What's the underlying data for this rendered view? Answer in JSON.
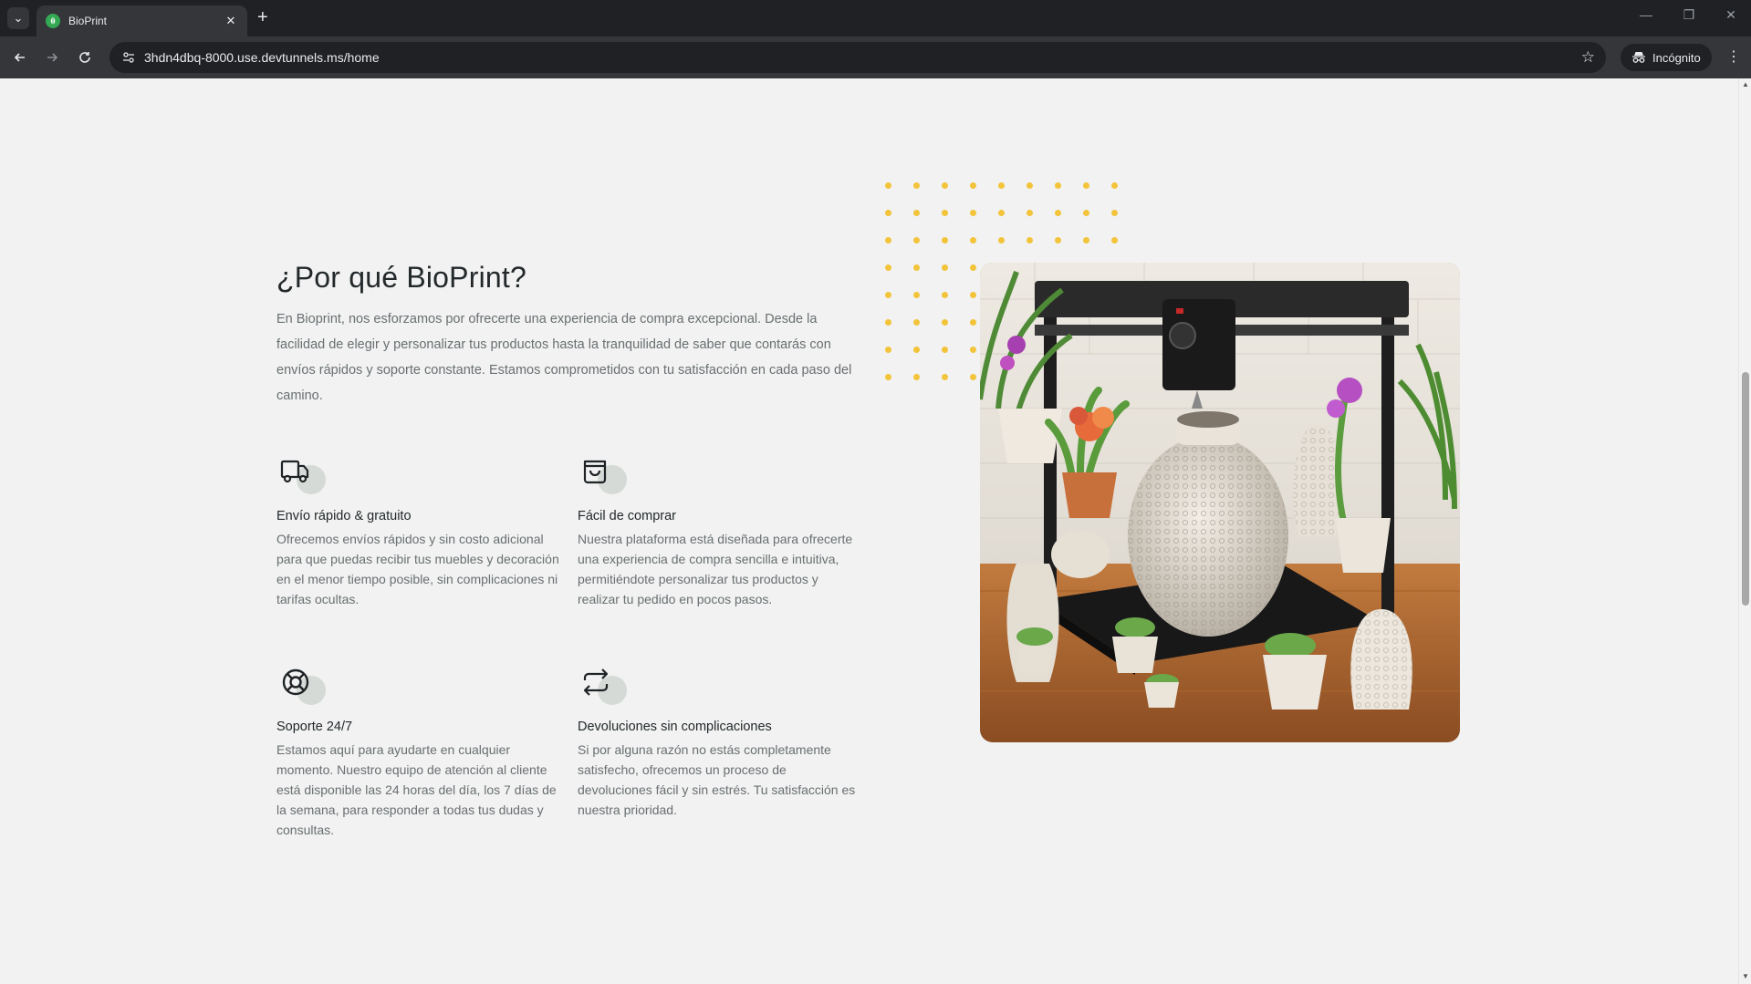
{
  "browser": {
    "tab_title": "BioPrint",
    "url_host": "3hdn4dbq-8000.use.devtunnels.ms",
    "url_path": "/home",
    "incognito_label": "Incógnito"
  },
  "section": {
    "title": "¿Por qué BioPrint?",
    "intro": "En Bioprint, nos esforzamos por ofrecerte una experiencia de compra excepcional. Desde la facilidad de elegir y personalizar tus productos hasta la tranquilidad de saber que contarás con envíos rápidos y soporte constante. Estamos comprometidos con tu satisfacción en cada paso del camino."
  },
  "features": [
    {
      "icon": "truck-icon",
      "title": "Envío rápido & gratuito",
      "text": "Ofrecemos envíos rápidos y sin costo adicional para que puedas recibir tus muebles y decoración en el menor tiempo posible, sin complicaciones ni tarifas ocultas."
    },
    {
      "icon": "shopping-bag-icon",
      "title": "Fácil de comprar",
      "text": "Nuestra plataforma está diseñada para ofrecerte una experiencia de compra sencilla e intuitiva, permitiéndote personalizar tus productos y realizar tu pedido en pocos pasos."
    },
    {
      "icon": "lifebuoy-icon",
      "title": "Soporte 24/7",
      "text": "Estamos aquí para ayudarte en cualquier momento. Nuestro equipo de atención al cliente está disponible las 24 horas del día, los 7 días de la semana, para responder a todas tus dudas y consultas."
    },
    {
      "icon": "exchange-arrows-icon",
      "title": "Devoluciones sin complicaciones",
      "text": "Si por alguna razón no estás completamente satisfecho, ofrecemos un proceso de devoluciones fácil y sin estrés. Tu satisfacción es nuestra prioridad."
    }
  ],
  "colors": {
    "page_background": "#f1f2f1",
    "accent_dots": "#f3c33a",
    "heading": "#23282b",
    "body_text": "#6a6f72"
  }
}
